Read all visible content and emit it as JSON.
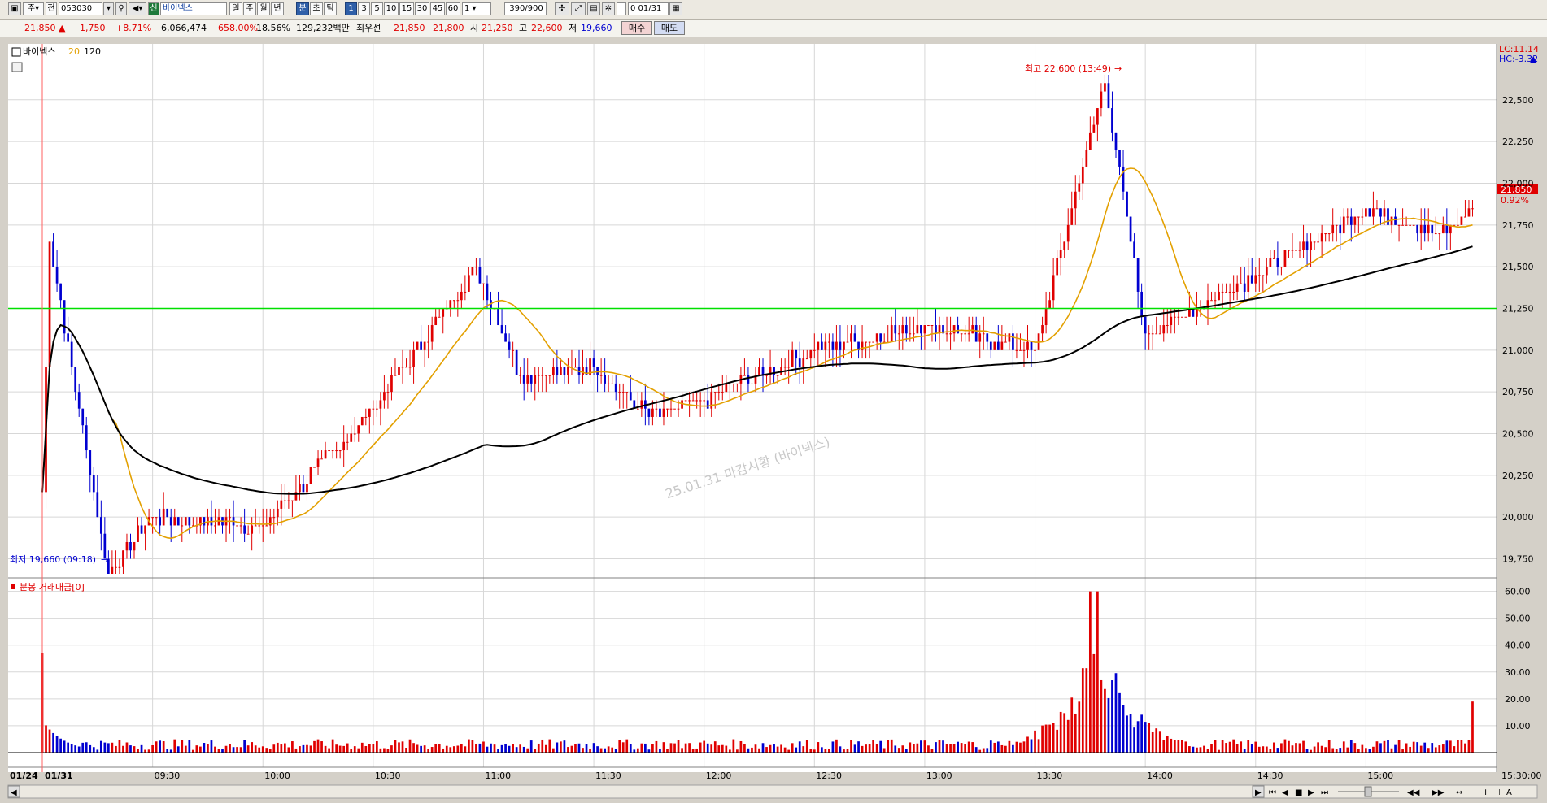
{
  "toolbar": {
    "stock_code": "053030",
    "stock_tag": "신",
    "stock_name": "바이넥스",
    "period_buttons": [
      "일",
      "주",
      "월",
      "년",
      "분",
      "초",
      "틱"
    ],
    "interval_buttons": [
      "1",
      "3",
      "5",
      "10",
      "15",
      "30",
      "45",
      "60"
    ],
    "interval_select": "1",
    "bar_count": "390/900",
    "date_value": "01/31",
    "prefix_labels": [
      "주",
      "전"
    ]
  },
  "quote": {
    "price": "21,850",
    "change_arrow": "▲",
    "change": "1,750",
    "change_pct": "+8.71%",
    "volume": "6,066,474",
    "volume_ratio": "658.00%",
    "turnover": "18.56%",
    "amount": "129,232백만",
    "best_label": "최우선",
    "best_ask": "21,850",
    "best_bid": "21,800",
    "open_label": "시",
    "open": "21,250",
    "high_label": "고",
    "high": "22,600",
    "low_label": "저",
    "low": "19,660",
    "buy_button": "매수",
    "sell_button": "매도"
  },
  "price_panel": {
    "legend_name": "바이넥스",
    "ma_short": "20",
    "ma_long": "120",
    "lc": "LC:11.14",
    "hc": "HC:-3.32",
    "high_marker": "최고 22,600 (13:49)",
    "low_marker": "최저 19,660 (09:18)",
    "current_price_label": "21,850",
    "current_pct_label": "0.92%",
    "watermark": "25.01.31 마감시황 (바이넥스)",
    "price_ticks": [
      "22,500",
      "22,250",
      "22,000",
      "21,750",
      "21,500",
      "21,250",
      "21,000",
      "20,750",
      "20,500",
      "20,250",
      "20,000",
      "19,750"
    ]
  },
  "volume_panel": {
    "legend": "분봉 거래대금[0]",
    "ticks": [
      "60.00",
      "50.00",
      "40.00",
      "30.00",
      "20.00",
      "10.00"
    ]
  },
  "time_axis": {
    "date_labels": [
      "01/24",
      "01/31"
    ],
    "time_labels": [
      "09:30",
      "10:00",
      "10:30",
      "11:00",
      "11:30",
      "12:00",
      "12:30",
      "13:00",
      "13:30",
      "14:00",
      "14:30",
      "15:00"
    ],
    "last_time": "15:30:00"
  },
  "colors": {
    "up": "#e00000",
    "down": "#0000d0",
    "ma20": "#e3a000",
    "ma120": "#000000",
    "level_line": "#00e000",
    "panel_bg": "#ffffff",
    "grid": "#d7d7d7"
  },
  "chart_data": {
    "type": "candlestick",
    "interval": "1 minute",
    "horizontal_line": 21250,
    "ylim": [
      19660,
      22650
    ],
    "volume_ylim": [
      0,
      62
    ],
    "key_points": [
      {
        "time": "09:00",
        "price": 20150
      },
      {
        "time": "09:02",
        "price": 21650
      },
      {
        "time": "09:18",
        "price": 19660
      },
      {
        "time": "09:30",
        "price": 20000
      },
      {
        "time": "10:00",
        "price": 19950
      },
      {
        "time": "10:30",
        "price": 20650
      },
      {
        "time": "10:58",
        "price": 21500
      },
      {
        "time": "11:10",
        "price": 20850
      },
      {
        "time": "11:30",
        "price": 20900
      },
      {
        "time": "11:45",
        "price": 20600
      },
      {
        "time": "12:00",
        "price": 20700
      },
      {
        "time": "12:30",
        "price": 21000
      },
      {
        "time": "13:00",
        "price": 21150
      },
      {
        "time": "13:30",
        "price": 21000
      },
      {
        "time": "13:49",
        "price": 22600
      },
      {
        "time": "14:00",
        "price": 21100
      },
      {
        "time": "14:30",
        "price": 21450
      },
      {
        "time": "15:00",
        "price": 21850
      },
      {
        "time": "15:20",
        "price": 21700
      },
      {
        "time": "15:30",
        "price": 21850
      }
    ],
    "volume_peaks": [
      {
        "time": "09:00",
        "value": 37
      },
      {
        "time": "13:45",
        "value": 60
      },
      {
        "time": "13:47",
        "value": 60
      },
      {
        "time": "15:30",
        "value": 19
      }
    ]
  }
}
